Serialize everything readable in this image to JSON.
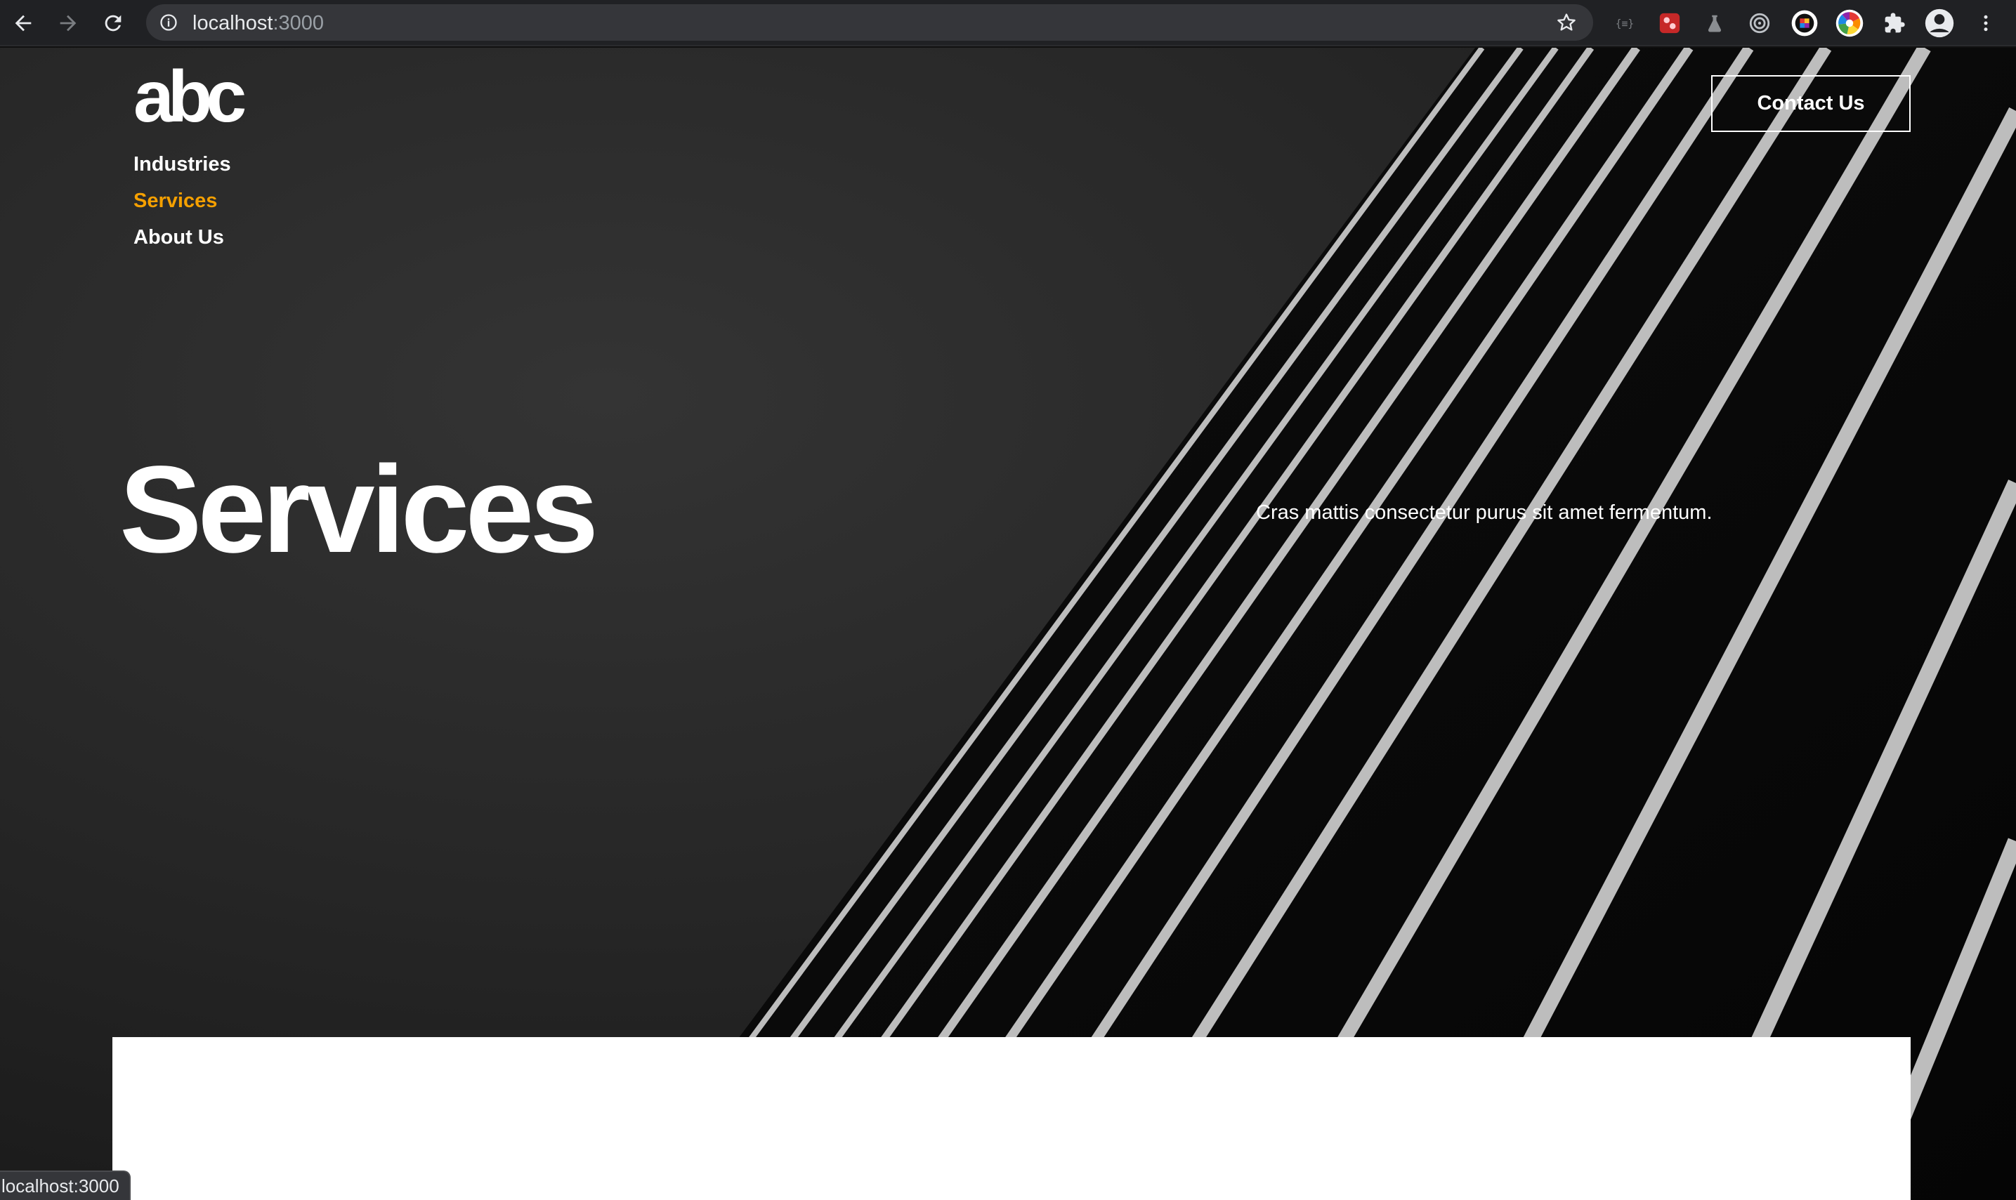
{
  "browser": {
    "url_host": "localhost",
    "url_port": ":3000",
    "back_icon": "arrow-left-icon",
    "forward_icon": "arrow-right-icon",
    "reload_icon": "reload-icon",
    "info_icon": "info-circle-icon",
    "bookmark_icon": "star-outline-icon",
    "extensions": [
      "braces-icon",
      "red-puzzle-extension-icon",
      "flask-icon",
      "target-icon",
      "palette-extension-icon",
      "color-wheel-icon",
      "puzzle-piece-icon",
      "account-circle-icon",
      "kebab-menu-icon"
    ]
  },
  "site": {
    "logo": "abc",
    "nav": [
      {
        "label": "Industries",
        "active": false
      },
      {
        "label": "Services",
        "active": true
      },
      {
        "label": "About Us",
        "active": false
      }
    ],
    "contact_label": "Contact Us",
    "accent_color": "#f5a000"
  },
  "hero": {
    "title": "Services",
    "text": "Cras mattis consectetur purus sit amet fermentum."
  },
  "status_bar": {
    "text": "localhost:3000"
  }
}
